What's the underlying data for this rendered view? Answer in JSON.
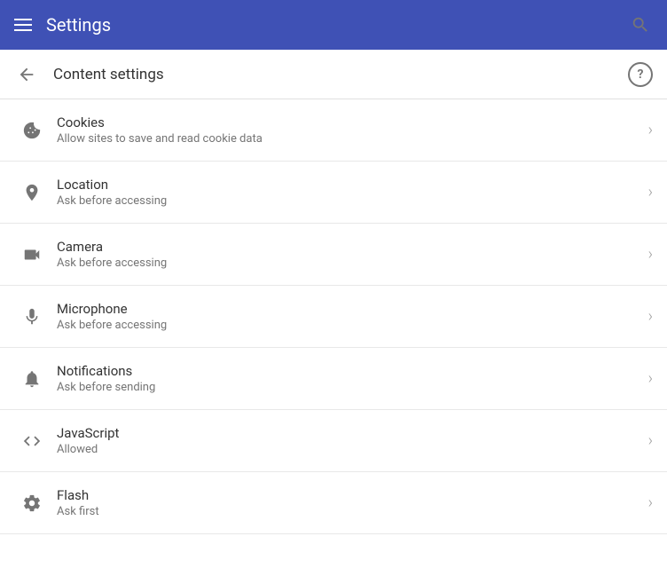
{
  "header": {
    "title": "Settings",
    "menu_icon": "hamburger",
    "search_icon": "search"
  },
  "subheader": {
    "title": "Content settings",
    "back_icon": "back-arrow",
    "help_icon": "help"
  },
  "items": [
    {
      "id": "cookies",
      "title": "Cookies",
      "subtitle": "Allow sites to save and read cookie data",
      "icon": "cookie"
    },
    {
      "id": "location",
      "title": "Location",
      "subtitle": "Ask before accessing",
      "icon": "location"
    },
    {
      "id": "camera",
      "title": "Camera",
      "subtitle": "Ask before accessing",
      "icon": "camera"
    },
    {
      "id": "microphone",
      "title": "Microphone",
      "subtitle": "Ask before accessing",
      "icon": "microphone"
    },
    {
      "id": "notifications",
      "title": "Notifications",
      "subtitle": "Ask before sending",
      "icon": "notifications"
    },
    {
      "id": "javascript",
      "title": "JavaScript",
      "subtitle": "Allowed",
      "icon": "javascript"
    },
    {
      "id": "flash",
      "title": "Flash",
      "subtitle": "Ask first",
      "icon": "flash"
    }
  ],
  "icons": {
    "chevron": "›"
  }
}
